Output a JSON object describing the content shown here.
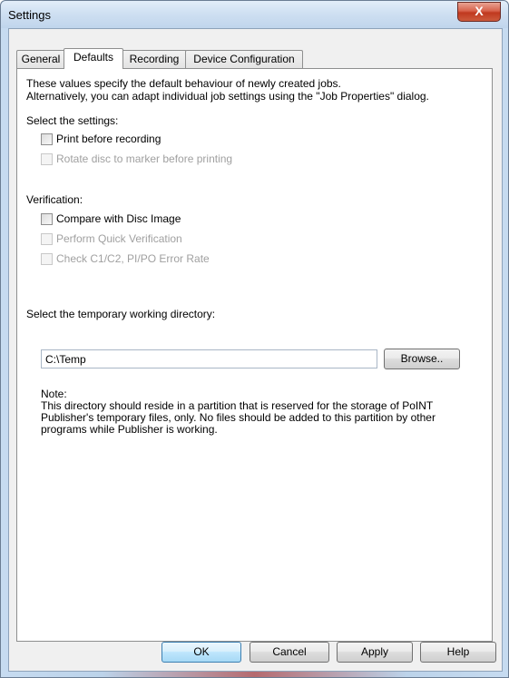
{
  "window": {
    "title": "Settings",
    "close_glyph": "X"
  },
  "tabs": [
    {
      "label": "General"
    },
    {
      "label": "Defaults"
    },
    {
      "label": "Recording"
    },
    {
      "label": "Device Configuration"
    }
  ],
  "intro": {
    "line1": "These values specify the default behaviour of newly created jobs.",
    "line2": "Alternatively, you can adapt individual job settings using the \"Job Properties\" dialog."
  },
  "settings_section": {
    "label": "Select the settings:",
    "options": [
      {
        "label": "Print before recording",
        "checked": false,
        "enabled": true
      },
      {
        "label": "Rotate disc to marker before printing",
        "checked": false,
        "enabled": false
      }
    ]
  },
  "verification_section": {
    "label": "Verification:",
    "options": [
      {
        "label": "Compare with Disc Image",
        "checked": false,
        "enabled": true
      },
      {
        "label": "Perform Quick Verification",
        "checked": false,
        "enabled": false
      },
      {
        "label": "Check C1/C2, PI/PO Error Rate",
        "checked": false,
        "enabled": false
      }
    ]
  },
  "directory": {
    "label": "Select the temporary working directory:",
    "value": "C:\\Temp",
    "browse_label": "Browse.."
  },
  "note": {
    "title": "Note:",
    "line1": "This directory should reside in a partition that is reserved for the storage of PoINT",
    "line2": "Publisher's temporary files, only. No files should be added to this partition by other",
    "line3": "programs while Publisher is working."
  },
  "buttons": {
    "ok": "OK",
    "cancel": "Cancel",
    "apply": "Apply",
    "help": "Help"
  },
  "colors": {
    "disabled_text": "#a0a0a0",
    "frame_accent": "#b56a6f",
    "default_button": "#bee6fd"
  }
}
